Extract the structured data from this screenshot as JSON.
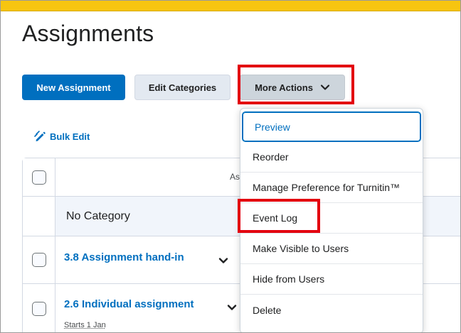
{
  "page": {
    "title": "Assignments"
  },
  "toolbar": {
    "new_assignment": "New Assignment",
    "edit_categories": "Edit Categories",
    "more_actions": "More Actions"
  },
  "bulk_edit": {
    "label": "Bulk Edit"
  },
  "table": {
    "header_label": "As",
    "category": "No Category",
    "rows": [
      {
        "title": "3.8 Assignment hand-in"
      },
      {
        "title": "2.6 Individual assignment",
        "subtext": "Starts 1 Jan"
      }
    ]
  },
  "dropdown": {
    "items": [
      {
        "label": "Preview"
      },
      {
        "label": "Reorder"
      },
      {
        "label": "Manage Preference for Turnitin™"
      },
      {
        "label": "Event Log"
      },
      {
        "label": "Make Visible to Users"
      },
      {
        "label": "Hide from Users"
      },
      {
        "label": "Delete"
      }
    ]
  },
  "colors": {
    "accent_bar": "#f7c510",
    "primary": "#006fbf",
    "highlight": "#e3000f"
  },
  "icons": {
    "bulk_edit": "pencil-icon",
    "more_actions": "chevron-down-icon",
    "row_menu": "chevron-down-icon",
    "row_key": "key-icon"
  }
}
